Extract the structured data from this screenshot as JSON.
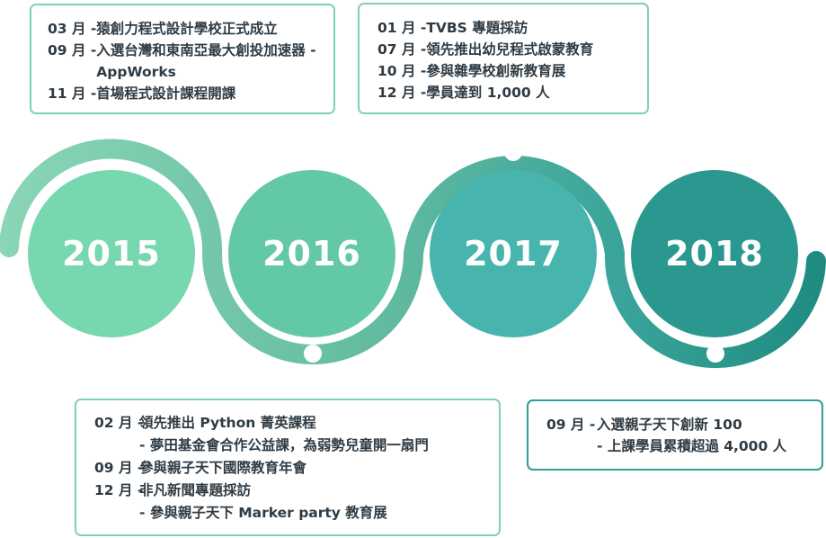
{
  "colors": {
    "c2015": "#77d7ae",
    "c2016": "#63c8a4",
    "c2017": "#47b5ad",
    "c2018": "#2b9890",
    "box_border_green": "#7fd1b3",
    "box_border_teal": "#2f9e96"
  },
  "years": [
    "2015",
    "2016",
    "2017",
    "2018"
  ],
  "box2015": [
    {
      "month": "03 月 - ",
      "text": "猿創力程式設計學校正式成立"
    },
    {
      "month": "09 月 - ",
      "text": "入選台灣和東南亞最大創投加速器 -AppWorks"
    },
    {
      "month": "11 月 - ",
      "text": "首場程式設計課程開課"
    }
  ],
  "box2016": [
    {
      "month": "02 月 - ",
      "text": "領先推出 Python 菁英課程"
    },
    {
      "month": "",
      "text": "- 夢田基金會合作公益課，為弱勢兒童開一扇門"
    },
    {
      "month": "09 月 - ",
      "text": "參與親子天下國際教育年會"
    },
    {
      "month": "12 月 - ",
      "text": "非凡新聞專題採訪"
    },
    {
      "month": "",
      "text": "- 參與親子天下 Marker party 教育展"
    }
  ],
  "box2017": [
    {
      "month": "01 月 -",
      "text": "TVBS 專題採訪"
    },
    {
      "month": "07 月 - ",
      "text": "領先推出幼兒程式啟蒙教育"
    },
    {
      "month": "10 月 - ",
      "text": "參與雜學校創新教育展"
    },
    {
      "month": "12 月 - ",
      "text": "學員達到 1,000 人"
    }
  ],
  "box2018": [
    {
      "month": "09 月 - ",
      "text": "入選親子天下創新 100"
    },
    {
      "month": "",
      "text": "- 上課學員累積超過 4,000 人"
    }
  ]
}
